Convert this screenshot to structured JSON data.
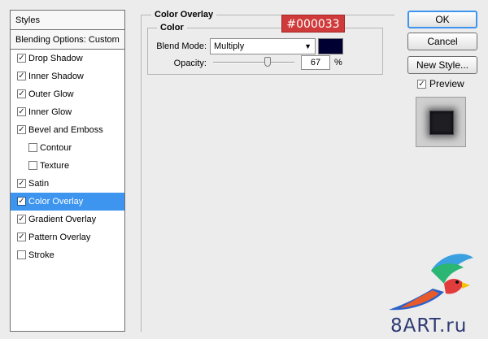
{
  "styles_panel": {
    "header": "Styles",
    "blending": "Blending Options: Custom",
    "items": [
      {
        "label": "Drop Shadow",
        "checked": true,
        "indent": false,
        "selected": false
      },
      {
        "label": "Inner Shadow",
        "checked": true,
        "indent": false,
        "selected": false
      },
      {
        "label": "Outer Glow",
        "checked": true,
        "indent": false,
        "selected": false
      },
      {
        "label": "Inner Glow",
        "checked": true,
        "indent": false,
        "selected": false
      },
      {
        "label": "Bevel and Emboss",
        "checked": true,
        "indent": false,
        "selected": false
      },
      {
        "label": "Contour",
        "checked": false,
        "indent": true,
        "selected": false
      },
      {
        "label": "Texture",
        "checked": false,
        "indent": true,
        "selected": false
      },
      {
        "label": "Satin",
        "checked": true,
        "indent": false,
        "selected": false
      },
      {
        "label": "Color Overlay",
        "checked": true,
        "indent": false,
        "selected": true
      },
      {
        "label": "Gradient Overlay",
        "checked": true,
        "indent": false,
        "selected": false
      },
      {
        "label": "Pattern Overlay",
        "checked": true,
        "indent": false,
        "selected": false
      },
      {
        "label": "Stroke",
        "checked": false,
        "indent": false,
        "selected": false
      }
    ]
  },
  "color_overlay": {
    "title": "Color Overlay",
    "section": "Color",
    "blend_mode_label": "Blend Mode:",
    "blend_mode_value": "Multiply",
    "opacity_label": "Opacity:",
    "opacity_value": "67",
    "opacity_unit": "%",
    "opacity_fraction": 0.67,
    "swatch_color": "#000033",
    "hex_badge": "#000033"
  },
  "buttons": {
    "ok": "OK",
    "cancel": "Cancel",
    "new_style": "New Style..."
  },
  "preview": {
    "label": "Preview",
    "checked": true
  },
  "watermark": "8ART.ru",
  "colors": {
    "selection": "#3d95f0",
    "badge": "#cf3b3b"
  }
}
